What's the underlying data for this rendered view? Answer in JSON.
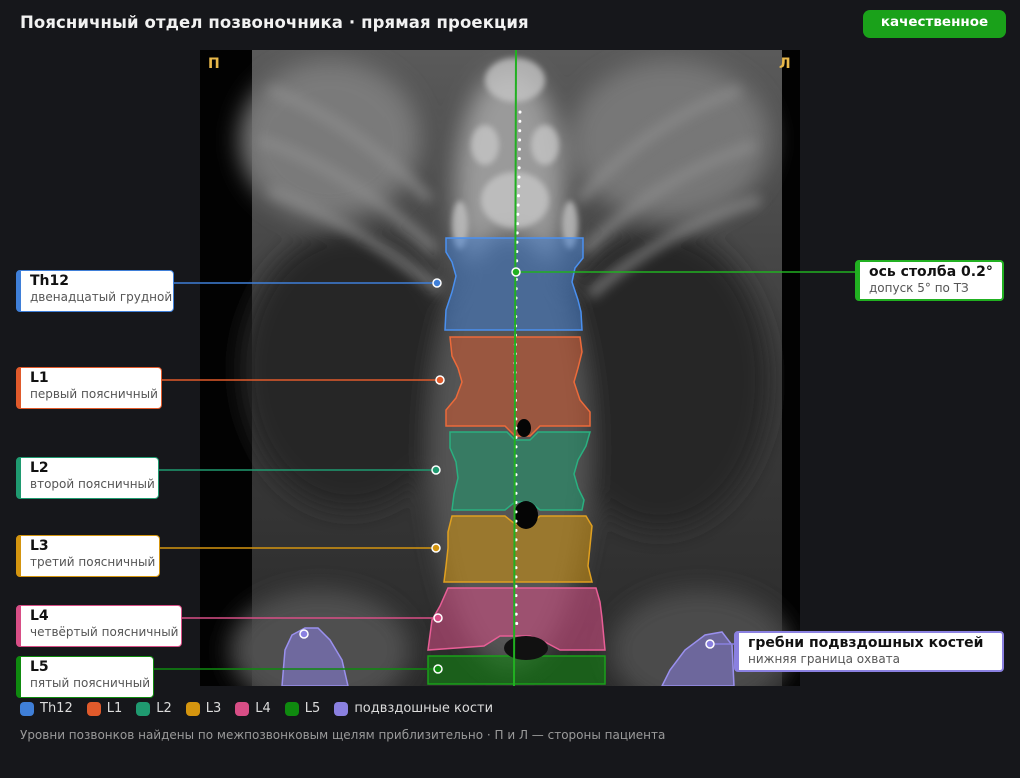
{
  "header": {
    "title": "Поясничный отдел позвоночника · прямая проекция",
    "badge": "качественное"
  },
  "sides": {
    "right_patient": "П",
    "left_patient": "Л"
  },
  "colors": {
    "th12": "#3f7fd8",
    "l1": "#e05a2b",
    "l2": "#1f9a70",
    "l3": "#d4950f",
    "l4": "#d84e86",
    "l5": "#0f8a0f",
    "iliac": "#8a80e0",
    "axis": "#21b021",
    "badge": "#1aa11a"
  },
  "vertebrae": [
    {
      "id": "th12",
      "name": "Th12",
      "desc": "двенадцатый грудной"
    },
    {
      "id": "l1",
      "name": "L1",
      "desc": "первый поясничный"
    },
    {
      "id": "l2",
      "name": "L2",
      "desc": "второй поясничный"
    },
    {
      "id": "l3",
      "name": "L3",
      "desc": "третий поясничный"
    },
    {
      "id": "l4",
      "name": "L4",
      "desc": "четвёртый поясничный"
    },
    {
      "id": "l5",
      "name": "L5",
      "desc": "пятый поясничный"
    }
  ],
  "axis_label": {
    "title": "ось столба 0.2°",
    "sub": "допуск 5° по ТЗ"
  },
  "iliac_label": {
    "title": "гребни подвздошных костей",
    "sub": "нижняя граница охвата"
  },
  "legend": [
    "Th12",
    "L1",
    "L2",
    "L3",
    "L4",
    "L5",
    "подвздошные кости"
  ],
  "footnote": "Уровни позвонков найдены по межпозвонковым щелям приблизительно · П и Л — стороны пациента"
}
